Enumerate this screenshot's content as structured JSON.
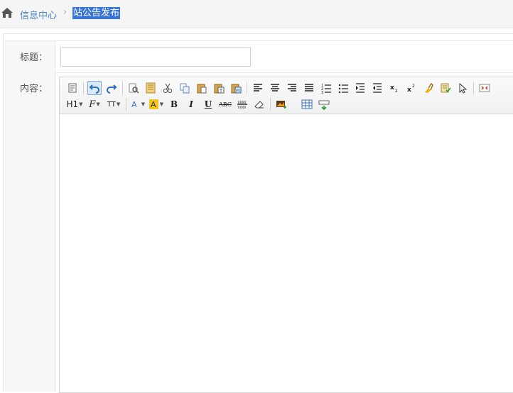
{
  "breadcrumb": {
    "home_icon": "home-icon",
    "home_label": "信息中心",
    "separator": "›",
    "current_label": "站公告发布"
  },
  "form": {
    "title_label": "标题：",
    "title_value": "",
    "content_label": "内容："
  },
  "toolbar": {
    "row1": [
      "source-icon",
      "undo-icon",
      "redo-icon",
      "preview-icon",
      "template-icon",
      "cut-icon",
      "copy-icon",
      "paste-icon",
      "paste-text-icon",
      "paste-word-icon",
      "align-left-icon",
      "align-center-icon",
      "align-right-icon",
      "align-justify-icon",
      "ordered-list-icon",
      "unordered-list-icon",
      "indent-icon",
      "outdent-icon",
      "subscript-icon",
      "superscript-icon",
      "clear-format-icon",
      "spellcheck-icon",
      "select-all-icon",
      "fullscreen-icon"
    ],
    "heading_label": "H1",
    "font_family_label": "F",
    "font_size_label": "TT",
    "bold_label": "B",
    "italic_label": "I",
    "underline_label": "U",
    "strike_label": "ABC",
    "colors": {
      "font_color": "#3b7ad0",
      "highlight": "#f5c518",
      "accent": "#3874d8"
    }
  }
}
